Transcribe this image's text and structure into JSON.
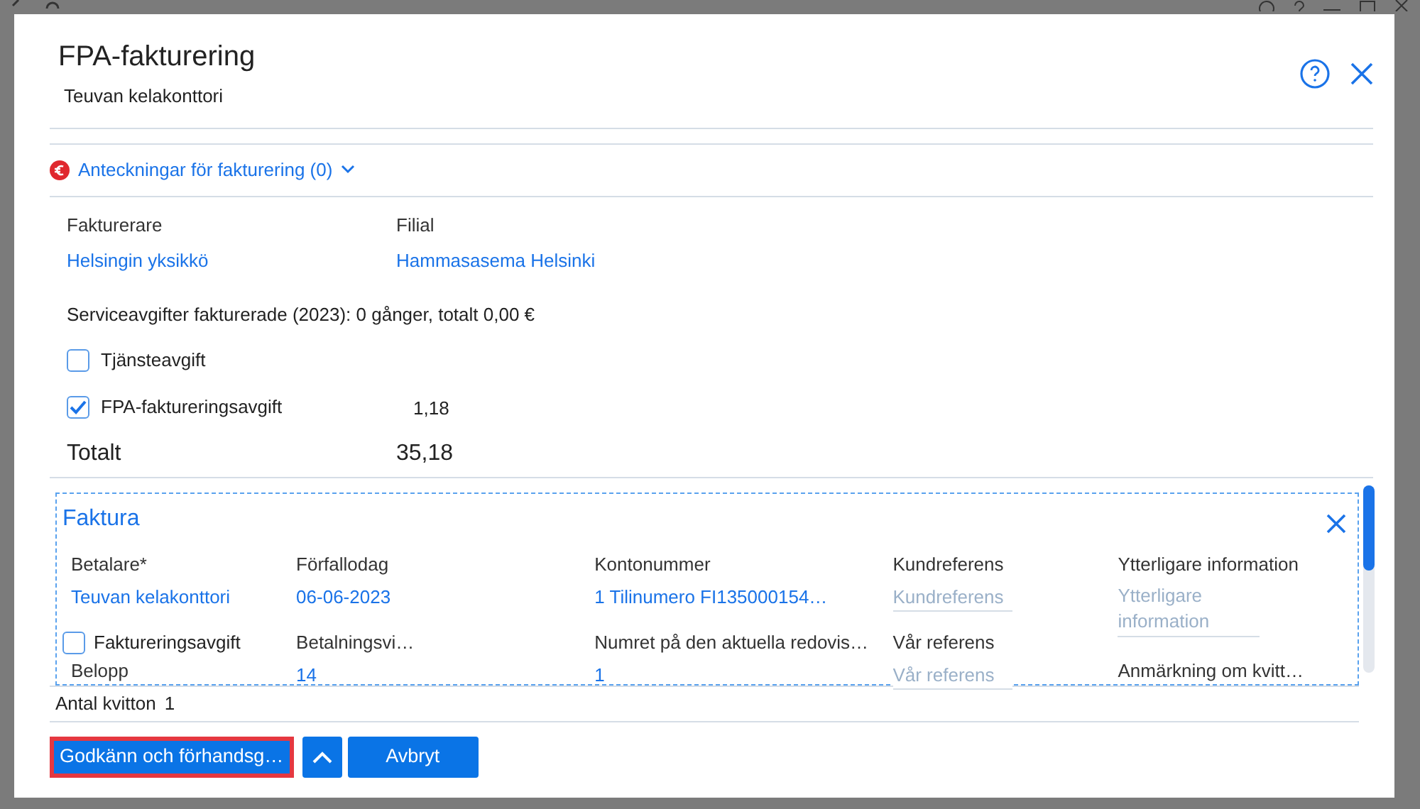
{
  "dialog": {
    "title": "FPA-fakturering",
    "subtitle": "Teuvan kelakonttori"
  },
  "notes": {
    "label": "Anteckningar för fakturering (0)",
    "expanded": false
  },
  "info": [
    {
      "label": "Fakturerare",
      "value": "Helsingin yksikkö"
    },
    {
      "label": "Filial",
      "value": "Hammasasema Helsinki"
    }
  ],
  "summary": "Serviceavgifter fakturerade (2023): 0 gånger, totalt 0,00 €",
  "fees": [
    {
      "label": "Tjänsteavgift",
      "checked": false
    },
    {
      "label": "FPA-faktureringsavgift",
      "checked": true,
      "amount": "1,18"
    }
  ],
  "total": {
    "label": "Totalt",
    "value": "35,18"
  },
  "invoice": {
    "title": "Faktura",
    "fields": [
      {
        "kind": "value",
        "label": "Betalare*",
        "value": "Teuvan kelakonttori"
      },
      {
        "kind": "value",
        "label": "Förfallodag",
        "value": "06-06-2023"
      },
      {
        "kind": "value",
        "label": "Kontonummer",
        "value": "1 Tilinumero FI135000154…"
      },
      {
        "kind": "input",
        "label": "Kundreferens",
        "placeholder": "Kundreferens"
      },
      {
        "kind": "input",
        "label": "Ytterligare information",
        "placeholder": "Ytterligare information"
      },
      {
        "kind": "checkbox",
        "label": "Faktureringsavgift",
        "checked": false,
        "sublabel": "Belopp"
      },
      {
        "kind": "value",
        "label": "Betalningsvi…",
        "value": "14"
      },
      {
        "kind": "value",
        "label": "Numret på den aktuella redovis…",
        "value": "1"
      },
      {
        "kind": "input",
        "label": "Vår referens",
        "placeholder": "Vår referens"
      },
      {
        "kind": "label",
        "label": "Anmärkning om kvitt…"
      }
    ]
  },
  "receipts": {
    "label": "Antal kvitton",
    "value": "1"
  },
  "buttons": [
    {
      "kind": "primary",
      "label": "Godkänn och förhandsg…",
      "focused": true
    },
    {
      "kind": "caret",
      "focused": false
    },
    {
      "kind": "primary",
      "label": "Avbryt",
      "focused": false
    }
  ]
}
